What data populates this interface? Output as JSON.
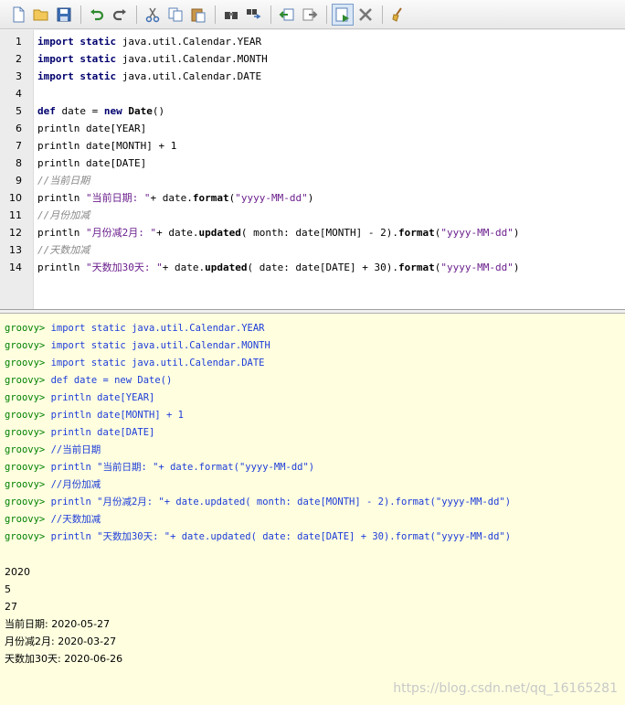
{
  "toolbar": {
    "buttons": [
      "new-file-icon",
      "open-folder-icon",
      "save-icon",
      "undo-icon",
      "redo-icon",
      "cut-icon",
      "copy-icon",
      "paste-icon",
      "find-icon",
      "replace-icon",
      "history-back-icon",
      "history-forward-icon",
      "run-script-icon",
      "interrupt-icon",
      "clear-output-icon"
    ]
  },
  "editor": {
    "line_numbers": [
      "1",
      "2",
      "3",
      "4",
      "5",
      "6",
      "7",
      "8",
      "9",
      "10",
      "11",
      "12",
      "13",
      "14"
    ],
    "lines": [
      [
        {
          "t": "import",
          "c": "kw"
        },
        {
          "t": " "
        },
        {
          "t": "static",
          "c": "kw"
        },
        {
          "t": " java.util.Calendar.YEAR"
        }
      ],
      [
        {
          "t": "import",
          "c": "kw"
        },
        {
          "t": " "
        },
        {
          "t": "static",
          "c": "kw"
        },
        {
          "t": " java.util.Calendar.MONTH"
        }
      ],
      [
        {
          "t": "import",
          "c": "kw"
        },
        {
          "t": " "
        },
        {
          "t": "static",
          "c": "kw"
        },
        {
          "t": " java.util.Calendar.DATE"
        }
      ],
      [],
      [
        {
          "t": "def",
          "c": "kw"
        },
        {
          "t": " date = "
        },
        {
          "t": "new",
          "c": "kw"
        },
        {
          "t": " "
        },
        {
          "t": "Date",
          "c": "meth"
        },
        {
          "t": "()"
        }
      ],
      [
        {
          "t": "println date[YEAR]"
        }
      ],
      [
        {
          "t": "println date[MONTH] + "
        },
        {
          "t": "1",
          "c": "num"
        }
      ],
      [
        {
          "t": "println date[DATE]"
        }
      ],
      [
        {
          "t": "//当前日期",
          "c": "cmt"
        }
      ],
      [
        {
          "t": "println "
        },
        {
          "t": "\"当前日期: \"",
          "c": "str"
        },
        {
          "t": "+ date."
        },
        {
          "t": "format",
          "c": "meth"
        },
        {
          "t": "("
        },
        {
          "t": "\"yyyy-MM-dd\"",
          "c": "str"
        },
        {
          "t": ")"
        }
      ],
      [
        {
          "t": "//月份加减",
          "c": "cmt"
        }
      ],
      [
        {
          "t": "println "
        },
        {
          "t": "\"月份减2月: \"",
          "c": "str"
        },
        {
          "t": "+ date."
        },
        {
          "t": "updated",
          "c": "meth"
        },
        {
          "t": "( month: date[MONTH] - "
        },
        {
          "t": "2",
          "c": "num"
        },
        {
          "t": ")."
        },
        {
          "t": "format",
          "c": "meth"
        },
        {
          "t": "("
        },
        {
          "t": "\"yyyy-MM-dd\"",
          "c": "str"
        },
        {
          "t": ")"
        }
      ],
      [
        {
          "t": "//天数加减",
          "c": "cmt"
        }
      ],
      [
        {
          "t": "println "
        },
        {
          "t": "\"天数加30天: \"",
          "c": "str"
        },
        {
          "t": "+ date."
        },
        {
          "t": "updated",
          "c": "meth"
        },
        {
          "t": "( date: date[DATE] + "
        },
        {
          "t": "30",
          "c": "num"
        },
        {
          "t": ")."
        },
        {
          "t": "format",
          "c": "meth"
        },
        {
          "t": "("
        },
        {
          "t": "\"yyyy-MM-dd\"",
          "c": "str"
        },
        {
          "t": ")"
        }
      ]
    ]
  },
  "console": {
    "prompt": "groovy> ",
    "commands": [
      "import static java.util.Calendar.YEAR",
      "import static java.util.Calendar.MONTH",
      "import static java.util.Calendar.DATE",
      "def date = new Date()",
      "println date[YEAR]",
      "println date[MONTH] + 1",
      "println date[DATE]",
      "//当前日期",
      "println \"当前日期: \"+ date.format(\"yyyy-MM-dd\")",
      "//月份加减",
      "println \"月份减2月: \"+ date.updated( month: date[MONTH] - 2).format(\"yyyy-MM-dd\")",
      "//天数加减",
      "println \"天数加30天: \"+ date.updated( date: date[DATE] + 30).format(\"yyyy-MM-dd\")"
    ],
    "output": [
      "2020",
      "5",
      "27",
      "当前日期: 2020-05-27",
      "月份减2月: 2020-03-27",
      "天数加30天: 2020-06-26"
    ]
  },
  "watermark": "https://blog.csdn.net/qq_16165281",
  "colors": {
    "keyword": "#00006e",
    "string": "#6a1e8c",
    "prompt": "#008000",
    "command": "#1c3bd8",
    "console_bg": "#ffffe0"
  }
}
